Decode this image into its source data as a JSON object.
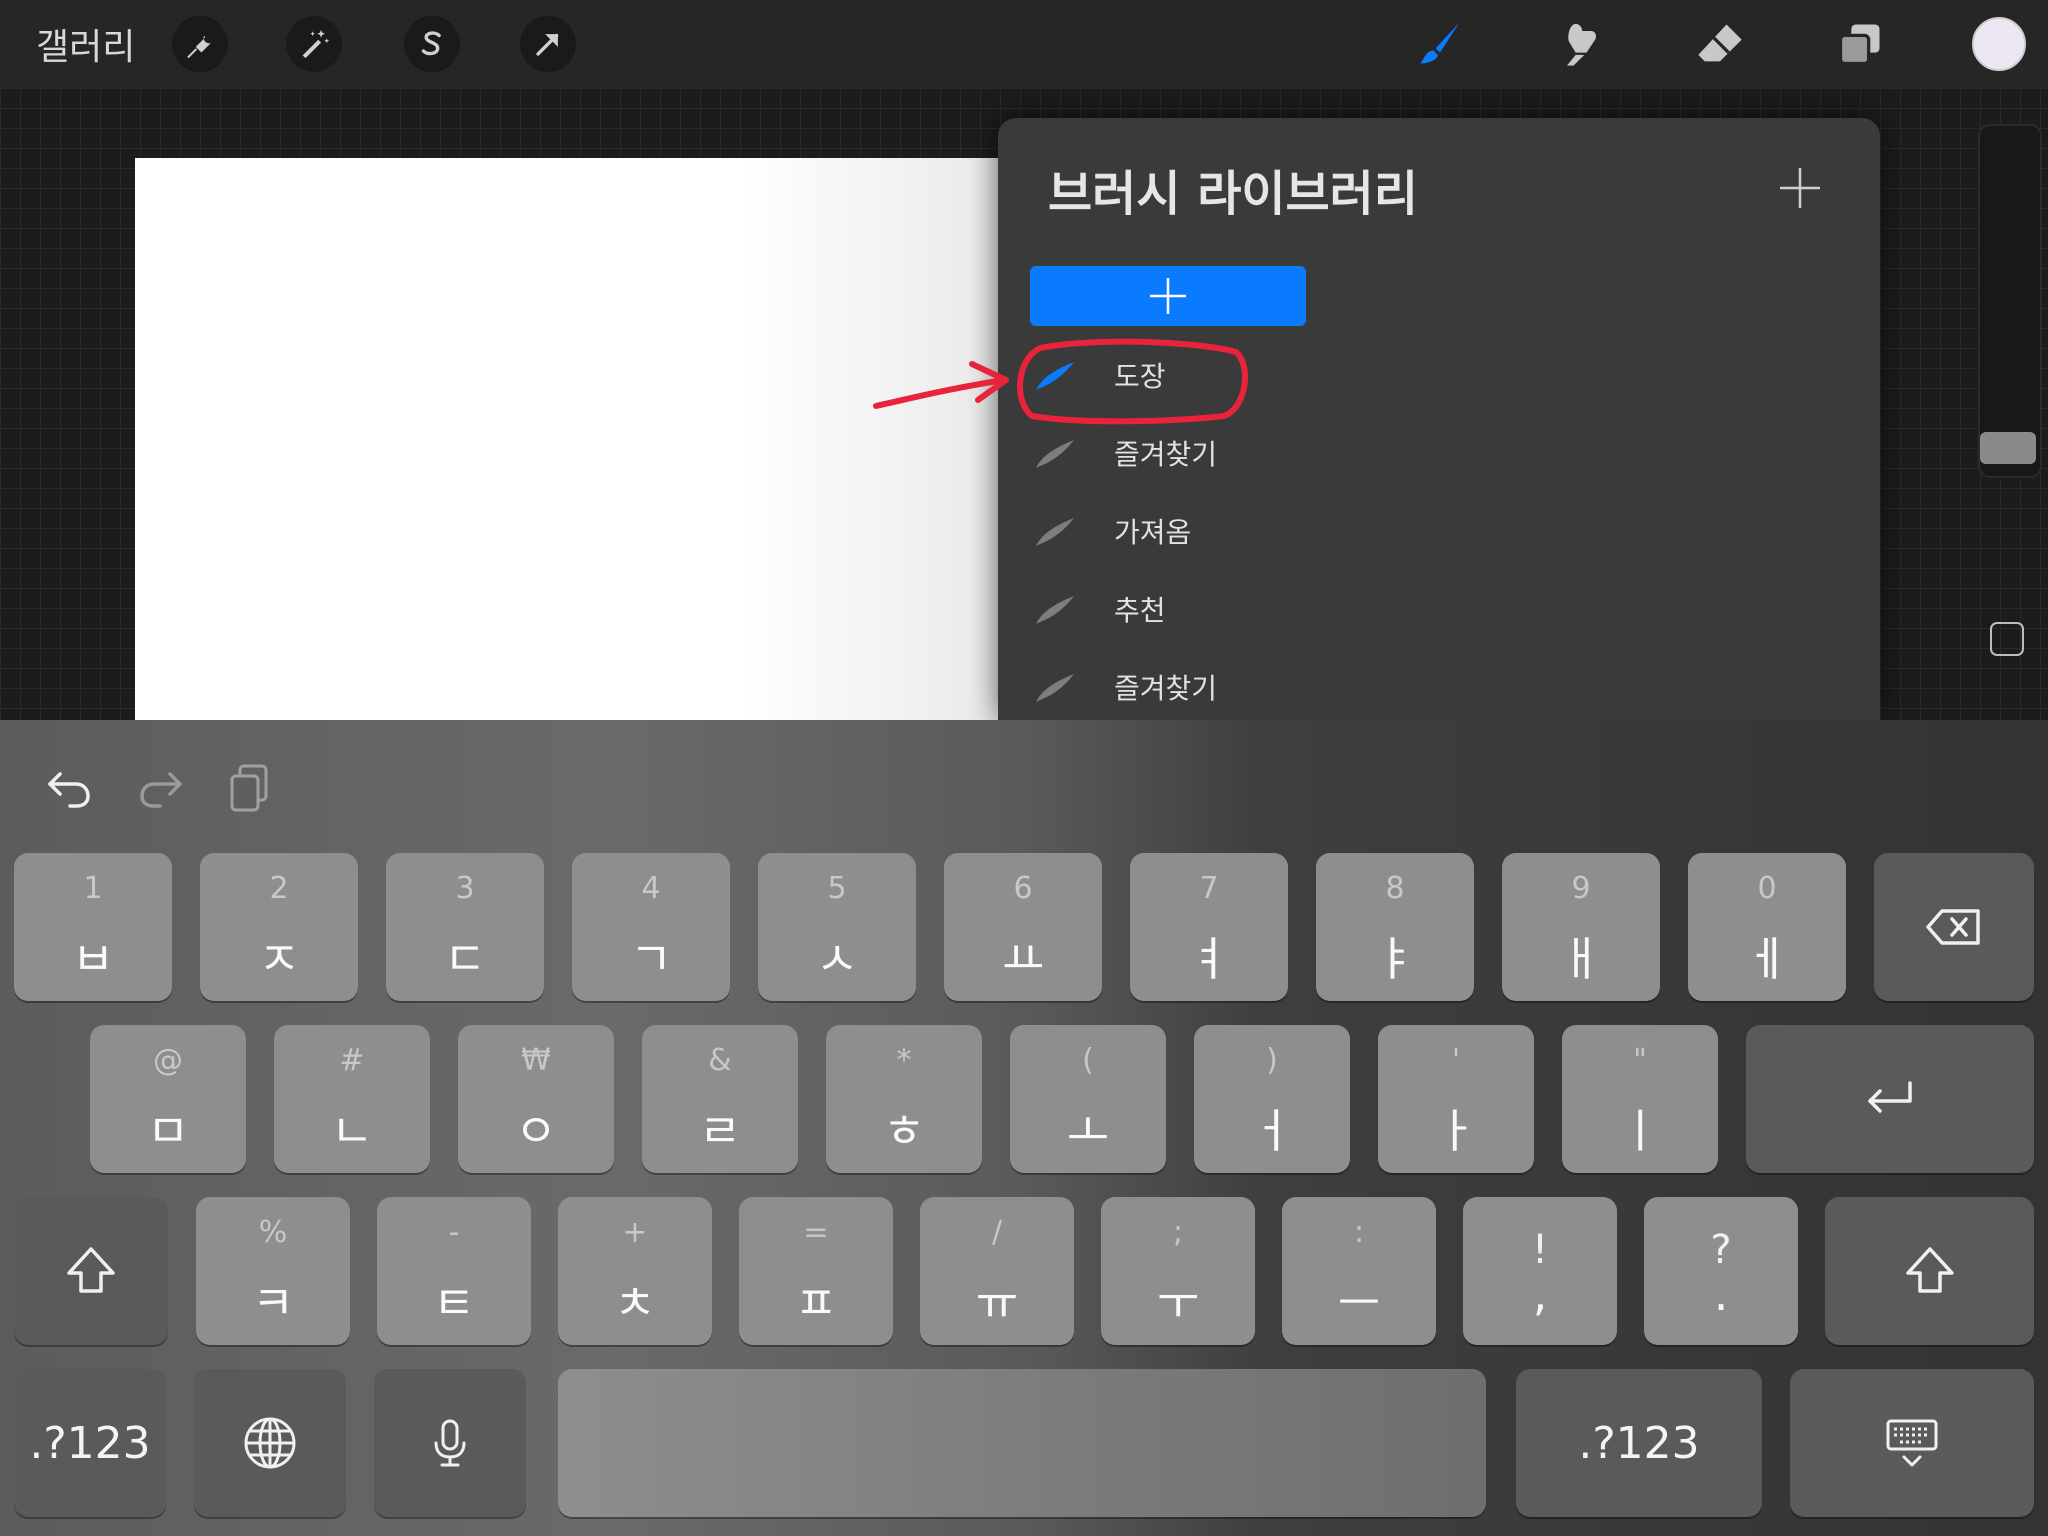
{
  "topbar": {
    "gallery_label": "갤러리",
    "left_tools": [
      "wrench-icon",
      "magic-wand-icon",
      "selection-s-icon",
      "move-arrow-icon"
    ],
    "right_tools": [
      "brush-icon",
      "smudge-icon",
      "eraser-icon",
      "layers-icon"
    ],
    "active_tool": "brush-icon",
    "accent_color": "#0a7aff",
    "current_color": "#ece7f2"
  },
  "brush_library": {
    "title": "브러시 라이브러리",
    "sets": [
      {
        "label": "도장",
        "selected": true
      },
      {
        "label": "즐겨찾기",
        "selected": false
      },
      {
        "label": "가져옴",
        "selected": false
      },
      {
        "label": "추천",
        "selected": false
      },
      {
        "label": "즐겨찾기",
        "selected": false
      }
    ],
    "annotation_color": "#e8233a"
  },
  "keyboard": {
    "row1": [
      {
        "sub": "1",
        "main": "ㅂ"
      },
      {
        "sub": "2",
        "main": "ㅈ"
      },
      {
        "sub": "3",
        "main": "ㄷ"
      },
      {
        "sub": "4",
        "main": "ㄱ"
      },
      {
        "sub": "5",
        "main": "ㅅ"
      },
      {
        "sub": "6",
        "main": "ㅛ"
      },
      {
        "sub": "7",
        "main": "ㅕ"
      },
      {
        "sub": "8",
        "main": "ㅑ"
      },
      {
        "sub": "9",
        "main": "ㅐ"
      },
      {
        "sub": "0",
        "main": "ㅔ"
      }
    ],
    "row2": [
      {
        "sub": "@",
        "main": "ㅁ"
      },
      {
        "sub": "#",
        "main": "ㄴ"
      },
      {
        "sub": "₩",
        "main": "ㅇ"
      },
      {
        "sub": "&",
        "main": "ㄹ"
      },
      {
        "sub": "*",
        "main": "ㅎ"
      },
      {
        "sub": "(",
        "main": "ㅗ"
      },
      {
        "sub": ")",
        "main": "ㅓ"
      },
      {
        "sub": "'",
        "main": "ㅏ"
      },
      {
        "sub": "\"",
        "main": "ㅣ"
      }
    ],
    "row3": [
      {
        "sub": "%",
        "main": "ㅋ"
      },
      {
        "sub": "-",
        "main": "ㅌ"
      },
      {
        "sub": "+",
        "main": "ㅊ"
      },
      {
        "sub": "=",
        "main": "ㅍ"
      },
      {
        "sub": "/",
        "main": "ㅠ"
      },
      {
        "sub": ";",
        "main": "ㅜ"
      },
      {
        "sub": ":",
        "main": "ㅡ"
      },
      {
        "sub": "!",
        "main": ","
      },
      {
        "sub": "?",
        "main": "."
      }
    ],
    "numbers_label": ".?123"
  }
}
